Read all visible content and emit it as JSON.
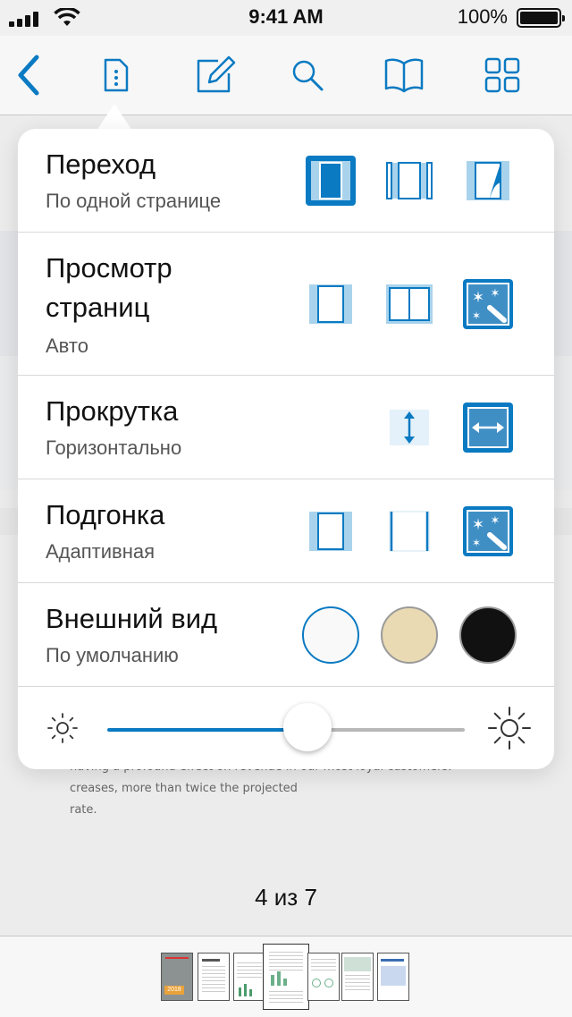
{
  "status_bar": {
    "time": "9:41 AM",
    "battery": "100%"
  },
  "toolbar": {
    "icons": [
      "back-icon",
      "document-menu-icon",
      "annotate-icon",
      "search-icon",
      "bookmarks-icon",
      "thumbnails-grid-icon"
    ]
  },
  "background_text": {
    "left_lines": [
      "having a profound effect on revenue in-",
      "creases, more than twice the projected",
      "rate."
    ],
    "right_lines": [
      "our most loyal customers."
    ]
  },
  "settings": {
    "transition": {
      "title": "Переход",
      "value": "По одной странице",
      "options": [
        "single-page-icon",
        "continuous-icon",
        "page-curl-icon"
      ],
      "selected": 0
    },
    "page_view": {
      "title_line1": "Просмотр",
      "title_line2": "страниц",
      "value": "Авто",
      "options": [
        "single-page-icon",
        "double-page-icon",
        "automatic-icon"
      ],
      "selected": 2
    },
    "scroll": {
      "title": "Прокрутка",
      "value": "Горизонтально",
      "options": [
        "vertical-scroll-icon",
        "horizontal-scroll-icon"
      ],
      "selected": 1
    },
    "fit": {
      "title": "Подгонка",
      "value": "Адаптивная",
      "options": [
        "fit-page-icon",
        "fit-width-icon",
        "adaptive-icon"
      ],
      "selected": 2
    },
    "appearance": {
      "title": "Внешний вид",
      "value": "По умолчанию",
      "themes": [
        {
          "name": "default",
          "color": "#f9f9f9"
        },
        {
          "name": "sepia",
          "color": "#e9dab3"
        },
        {
          "name": "night",
          "color": "#111111"
        }
      ],
      "selected": 0
    }
  },
  "brightness": {
    "level": 0.6
  },
  "page_indicator": "4 из 7",
  "thumbnails": {
    "count": 7,
    "current": 4,
    "cover_label": "2018"
  },
  "colors": {
    "accent": "#0a7ac2",
    "accent_light": "#a9d3ec",
    "separator": "#d8d8d8"
  }
}
